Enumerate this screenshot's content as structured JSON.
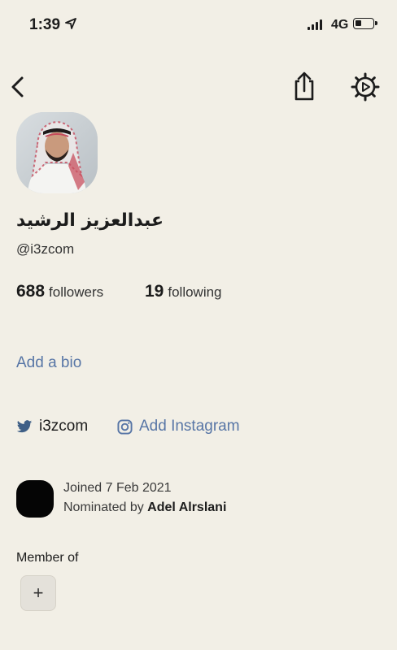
{
  "status_bar": {
    "time": "1:39",
    "network": "4G"
  },
  "profile": {
    "name": "عبدالعزيز الرشيد",
    "handle": "@i3zcom",
    "followers_count": "688",
    "followers_label": "followers",
    "following_count": "19",
    "following_label": "following",
    "bio_link": "Add a bio"
  },
  "social": {
    "twitter": "i3zcom",
    "instagram": "Add Instagram"
  },
  "joined": {
    "joined_text": "Joined 7 Feb 2021",
    "nominated_prefix": "Nominated by",
    "nominated_by": "Adel Alrslani"
  },
  "clubs": {
    "heading": "Member of",
    "add_label": "+"
  },
  "icons": {
    "back": "chevron-left-icon",
    "share": "share-icon",
    "settings": "gear-icon",
    "twitter": "twitter-icon",
    "instagram": "instagram-icon",
    "location": "location-arrow-icon"
  },
  "colors": {
    "background": "#f2efe6",
    "link": "#5876a6"
  }
}
